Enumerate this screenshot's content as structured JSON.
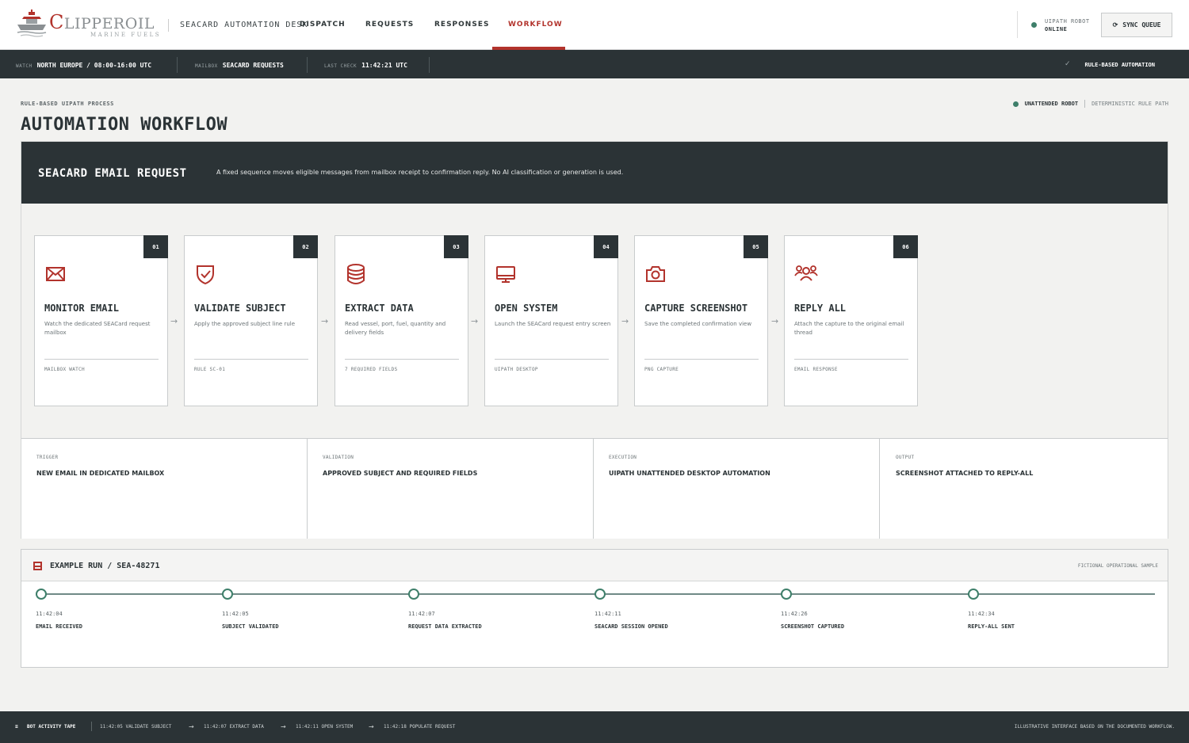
{
  "brand": {
    "name_initial": "C",
    "name_rest": "LIPPEROIL",
    "tagline": "MARINE FUELS",
    "colors": {
      "accent": "#b2332c",
      "dark": "#2b3336",
      "online": "#3e7f6a"
    }
  },
  "header": {
    "desk_title": "SEACARD AUTOMATION DESK",
    "nav": [
      "DISPATCH",
      "REQUESTS",
      "RESPONSES",
      "WORKFLOW"
    ],
    "active_nav": "WORKFLOW",
    "robot_label": "UIPATH ROBOT",
    "robot_status": "ONLINE",
    "sync_button": "SYNC QUEUE"
  },
  "statusbar": {
    "watch_label": "WATCH",
    "watch_value": "NORTH EUROPE / 08:00-16:00 UTC",
    "mailbox_label": "MAILBOX",
    "mailbox_value": "SEACARD REQUESTS",
    "check_label": "LAST CHECK",
    "check_value": "11:42:21 UTC",
    "right_label": "RULE-BASED AUTOMATION"
  },
  "page": {
    "eyebrow": "RULE-BASED UIPATH PROCESS",
    "title": "AUTOMATION WORKFLOW",
    "robot_mode": "UNATTENDED ROBOT",
    "rule_path": "DETERMINISTIC RULE PATH"
  },
  "panel": {
    "title": "SEACARD EMAIL REQUEST",
    "description": "A fixed sequence moves eligible messages from mailbox receipt to confirmation reply. No AI classification or generation is used.",
    "steps": [
      {
        "num": "01",
        "icon": "envelope-icon",
        "title": "MONITOR EMAIL",
        "desc": "Watch the dedicated SEACard request mailbox",
        "tag": "MAILBOX WATCH"
      },
      {
        "num": "02",
        "icon": "shield-check-icon",
        "title": "VALIDATE SUBJECT",
        "desc": "Apply the approved subject line rule",
        "tag": "RULE SC-01"
      },
      {
        "num": "03",
        "icon": "database-icon",
        "title": "EXTRACT DATA",
        "desc": "Read vessel, port, fuel, quantity and delivery fields",
        "tag": "7 REQUIRED FIELDS"
      },
      {
        "num": "04",
        "icon": "monitor-icon",
        "title": "OPEN SYSTEM",
        "desc": "Launch the SEACard request entry screen",
        "tag": "UIPATH DESKTOP"
      },
      {
        "num": "05",
        "icon": "camera-icon",
        "title": "CAPTURE SCREENSHOT",
        "desc": "Save the completed confirmation view",
        "tag": "PNG CAPTURE"
      },
      {
        "num": "06",
        "icon": "users-icon",
        "title": "REPLY ALL",
        "desc": "Attach the capture to the original email thread",
        "tag": "EMAIL RESPONSE"
      }
    ],
    "summary": [
      {
        "label": "TRIGGER",
        "value": "NEW EMAIL IN DEDICATED MAILBOX"
      },
      {
        "label": "VALIDATION",
        "value": "APPROVED SUBJECT AND REQUIRED FIELDS"
      },
      {
        "label": "EXECUTION",
        "value": "UIPATH UNATTENDED DESKTOP AUTOMATION"
      },
      {
        "label": "OUTPUT",
        "value": "SCREENSHOT ATTACHED TO REPLY-ALL"
      }
    ]
  },
  "run": {
    "title": "EXAMPLE RUN / SEA-48271",
    "note": "FICTIONAL OPERATIONAL SAMPLE",
    "events": [
      {
        "time": "11:42:04",
        "label": "EMAIL RECEIVED"
      },
      {
        "time": "11:42:05",
        "label": "SUBJECT VALIDATED"
      },
      {
        "time": "11:42:07",
        "label": "REQUEST DATA EXTRACTED"
      },
      {
        "time": "11:42:11",
        "label": "SEACARD SESSION OPENED"
      },
      {
        "time": "11:42:26",
        "label": "SCREENSHOT CAPTURED"
      },
      {
        "time": "11:42:34",
        "label": "REPLY-ALL SENT"
      }
    ]
  },
  "tape": {
    "title": "BOT ACTIVITY TAPE",
    "items": [
      "11:42:05 VALIDATE SUBJECT",
      "11:42:07 EXTRACT DATA",
      "11:42:11 OPEN SYSTEM",
      "11:42:18 POPULATE REQUEST"
    ],
    "footer": "ILLUSTRATIVE INTERFACE BASED ON THE DOCUMENTED WORKFLOW."
  }
}
